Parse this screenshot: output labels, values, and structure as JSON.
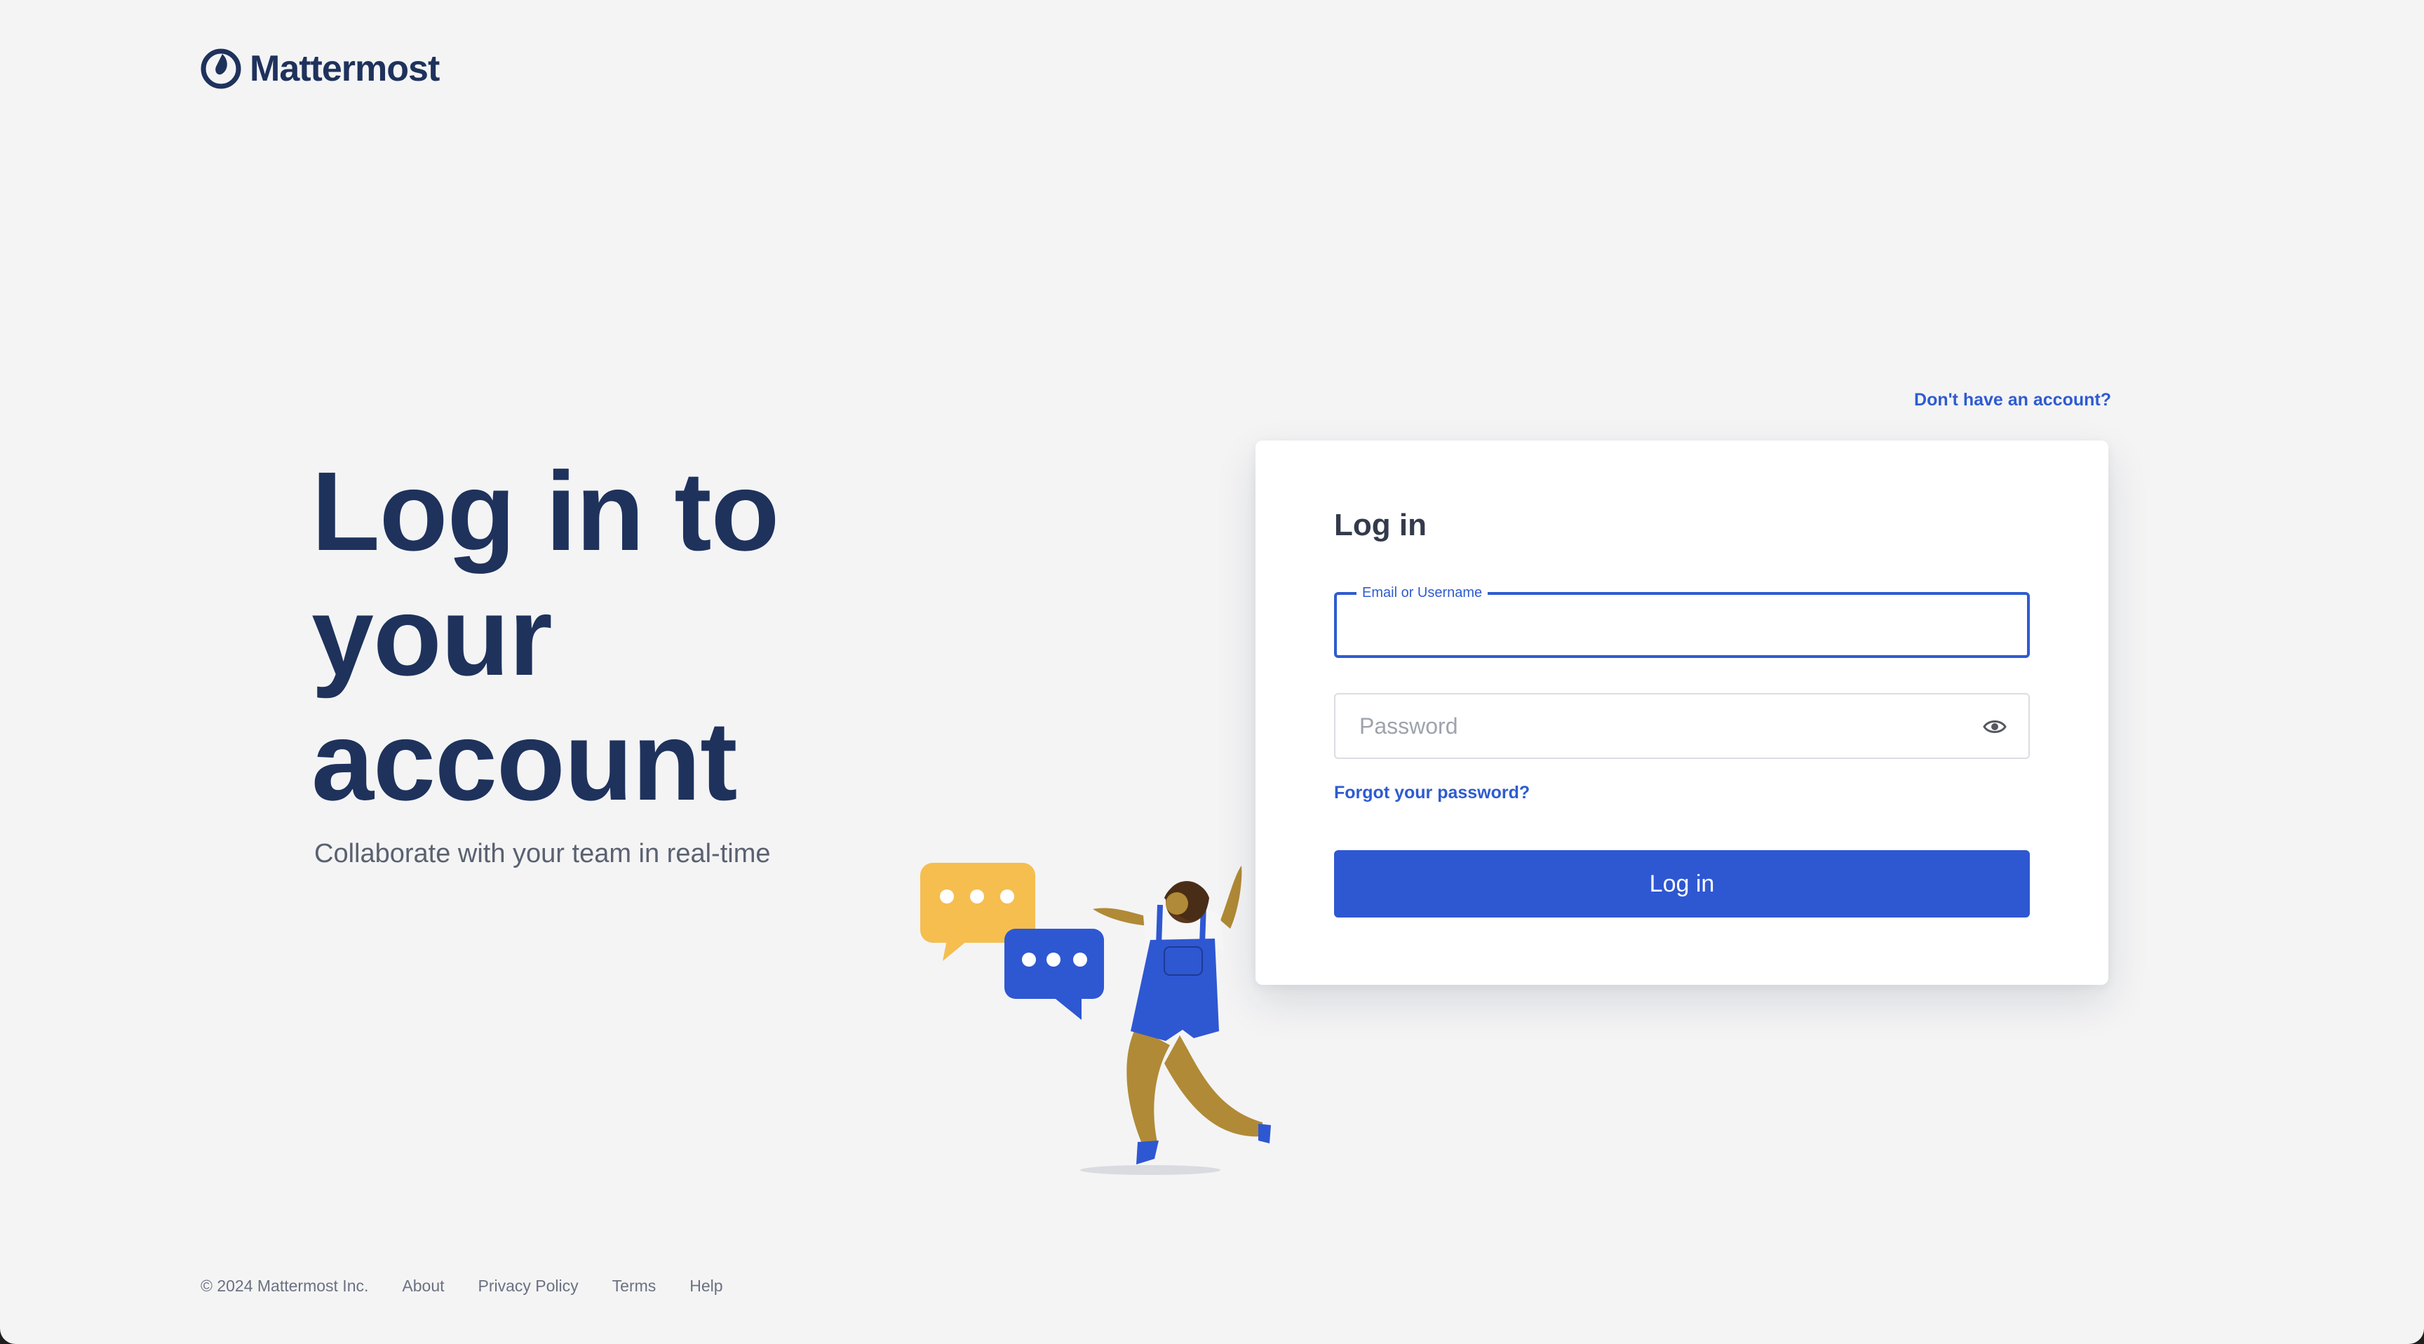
{
  "brand": {
    "name": "Mattermost",
    "accent_color": "#2e5bd0",
    "text_color": "#1e325c"
  },
  "hero": {
    "title": "Log in to your account",
    "subtitle": "Collaborate with your team in real-time"
  },
  "signup": {
    "link_label": "Don't have an account?"
  },
  "login_card": {
    "title": "Log in",
    "email_label": "Email or Username",
    "email_value": "",
    "password_placeholder": "Password",
    "password_value": "",
    "show_password_icon": "eye-icon",
    "forgot_label": "Forgot your password?",
    "submit_label": "Log in"
  },
  "footer": {
    "copyright": "© 2024 Mattermost Inc.",
    "links": [
      "About",
      "Privacy Policy",
      "Terms",
      "Help"
    ]
  }
}
